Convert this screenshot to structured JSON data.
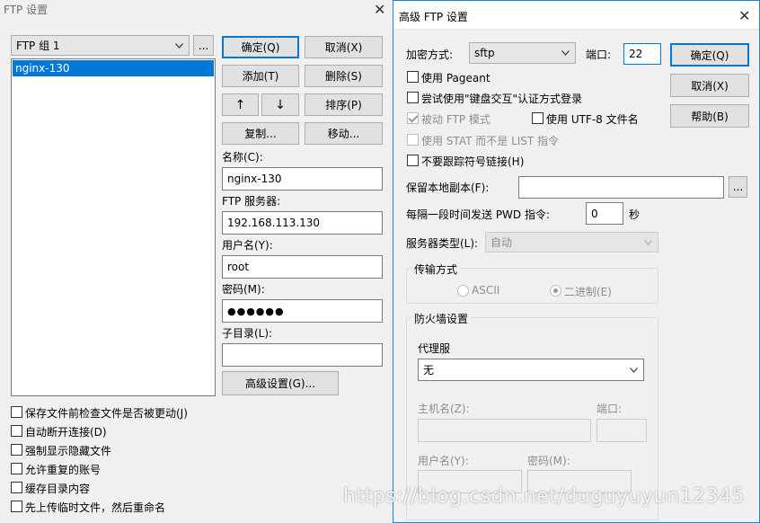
{
  "back": {
    "title": "FTP 设置",
    "group_select": "FTP 组 1",
    "group_more": "...",
    "list_items": [
      "nginx-130"
    ],
    "buttons": {
      "ok": "确定(Q)",
      "cancel": "取消(X)",
      "add": "添加(T)",
      "delete": "删除(S)",
      "up": "↑",
      "down": "↓",
      "sort": "排序(P)",
      "copy": "复制...",
      "move": "移动...",
      "advanced": "高级设置(G)..."
    },
    "fields": {
      "name_label": "名称(C):",
      "name_value": "nginx-130",
      "server_label": "FTP 服务器:",
      "server_value": "192.168.113.130",
      "user_label": "用户名(Y):",
      "user_value": "root",
      "password_label": "密码(M):",
      "password_value": "●●●●●●",
      "dir_label": "子目录(L):",
      "dir_value": ""
    },
    "checkboxes": [
      "保存文件前检查文件是否被更动(J)",
      "自动断开连接(D)",
      "强制显示隐藏文件",
      "允许重复的账号",
      "缓存目录内容",
      "先上传临时文件，然后重命名"
    ]
  },
  "front": {
    "title": "高级 FTP 设置",
    "encryption_label": "加密方式:",
    "encryption_value": "sftp",
    "port_label": "端口:",
    "port_value": "22",
    "ok": "确定(Q)",
    "cancel": "取消(X)",
    "help": "帮助(B)",
    "use_pageant": "使用 Pageant",
    "try_keyboard": "尝试使用\"键盘交互\"认证方式登录",
    "passive_ftp": "被动 FTP 模式",
    "use_utf8": "使用 UTF-8 文件名",
    "use_stat": "使用 STAT 而不是 LIST 指令",
    "no_symlinks": "不要跟踪符号链接(H)",
    "keep_local_label": "保留本地副本(F):",
    "keep_local_value": "",
    "keep_local_more": "...",
    "pwd_label": "每隔一段时间发送 PWD 指令:",
    "pwd_value": "0",
    "pwd_unit": "秒",
    "server_type_label": "服务器类型(L):",
    "server_type_value": "自动",
    "transfer_group": "传输方式",
    "ascii": "ASCII",
    "binary": "二进制(E)",
    "firewall_group": "防火墙设置",
    "proxy_label": "代理服",
    "proxy_value": "无",
    "host_label": "主机名(Z):",
    "fw_port_label": "端口:",
    "fw_user_label": "用户名(Y):",
    "fw_password_label": "密码(M):"
  },
  "watermark": "https://blog.csdn.net/duguyuyun12345"
}
